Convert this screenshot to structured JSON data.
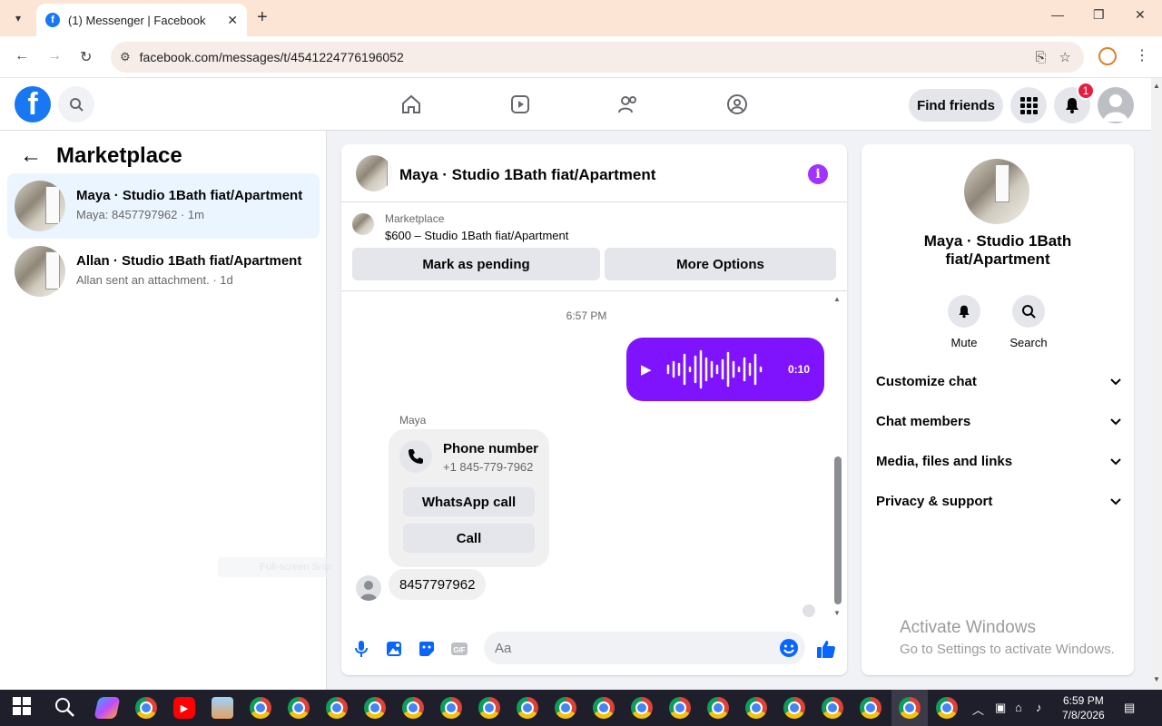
{
  "browser": {
    "tab_title": "(1) Messenger | Facebook",
    "url": "facebook.com/messages/t/4541224776196052"
  },
  "header": {
    "find_friends": "Find friends",
    "notification_count": "1"
  },
  "sidebar": {
    "title": "Marketplace",
    "conversations": [
      {
        "name": "Maya · Studio 1Bath fiat/Apartment",
        "preview": "Maya: 8457797962 · 1m"
      },
      {
        "name": "Allan · Studio 1Bath fiat/Apartment",
        "preview": "Allan sent an attachment. · 1d"
      }
    ]
  },
  "chat": {
    "title": "Maya · Studio 1Bath fiat/Apartment",
    "marketplace_label": "Marketplace",
    "listing": "$600 – Studio 1Bath fiat/Apartment",
    "mark_pending": "Mark as pending",
    "more_options": "More Options",
    "timestamp": "6:57 PM",
    "voice_duration": "0:10",
    "sender": "Maya",
    "phone_card": {
      "title": "Phone number",
      "number": "+1 845-779-7962",
      "whatsapp": "WhatsApp call",
      "call": "Call"
    },
    "last_message": "8457797962",
    "composer_placeholder": "Aa"
  },
  "info_panel": {
    "name": "Maya · Studio 1Bath fiat/Apartment",
    "mute": "Mute",
    "search": "Search",
    "sections": [
      "Customize chat",
      "Chat members",
      "Media, files and links",
      "Privacy & support"
    ]
  },
  "watermark": {
    "line1": "Activate Windows",
    "line2": "Go to Settings to activate Windows."
  },
  "ghost_label": "Full-screen Snip",
  "taskbar": {
    "time": "6:59 PM",
    "date": "7/8/2026"
  },
  "colors": {
    "facebook_blue": "#1877f2",
    "messenger_purple": "#8013fe",
    "badge_red": "#e41e3f"
  }
}
